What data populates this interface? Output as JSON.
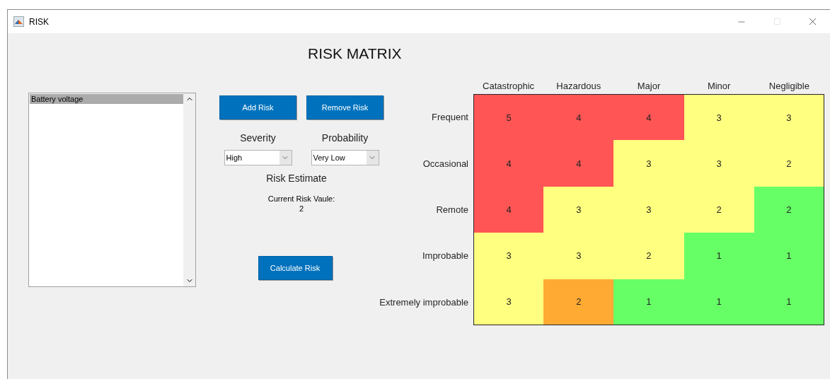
{
  "window": {
    "title": "RISK",
    "maximize_enabled": false
  },
  "heading": "RISK MATRIX",
  "risk_list": {
    "items": [
      {
        "label": "Battery voltage",
        "selected": true
      }
    ]
  },
  "buttons": {
    "add": "Add Risk",
    "remove": "Remove Risk",
    "calculate": "Calculate Risk"
  },
  "severity": {
    "label": "Severity",
    "value": "High"
  },
  "probability": {
    "label": "Probability",
    "value": "Very Low"
  },
  "estimate": {
    "title": "Risk Estimate",
    "caption": "Current Risk Vaule:",
    "value": "2"
  },
  "matrix": {
    "columns": [
      "Catastrophic",
      "Hazardous",
      "Major",
      "Minor",
      "Negligible"
    ],
    "rows": [
      {
        "label": "Frequent",
        "cells": [
          {
            "value": "5",
            "color": "#ff5555"
          },
          {
            "value": "4",
            "color": "#ff5555"
          },
          {
            "value": "4",
            "color": "#ff5555"
          },
          {
            "value": "3",
            "color": "#ffff80"
          },
          {
            "value": "3",
            "color": "#ffff80"
          }
        ]
      },
      {
        "label": "Occasional",
        "cells": [
          {
            "value": "4",
            "color": "#ff5555"
          },
          {
            "value": "4",
            "color": "#ff5555"
          },
          {
            "value": "3",
            "color": "#ffff80"
          },
          {
            "value": "3",
            "color": "#ffff80"
          },
          {
            "value": "2",
            "color": "#ffff80"
          }
        ]
      },
      {
        "label": "Remote",
        "cells": [
          {
            "value": "4",
            "color": "#ff5555"
          },
          {
            "value": "3",
            "color": "#ffff80"
          },
          {
            "value": "3",
            "color": "#ffff80"
          },
          {
            "value": "2",
            "color": "#ffff80"
          },
          {
            "value": "2",
            "color": "#66ff66"
          }
        ]
      },
      {
        "label": "Improbable",
        "cells": [
          {
            "value": "3",
            "color": "#ffff80"
          },
          {
            "value": "3",
            "color": "#ffff80"
          },
          {
            "value": "2",
            "color": "#ffff80"
          },
          {
            "value": "1",
            "color": "#66ff66"
          },
          {
            "value": "1",
            "color": "#66ff66"
          }
        ]
      },
      {
        "label": "Extremely improbable",
        "cells": [
          {
            "value": "3",
            "color": "#ffff80"
          },
          {
            "value": "2",
            "color": "#ffaa33"
          },
          {
            "value": "1",
            "color": "#66ff66"
          },
          {
            "value": "1",
            "color": "#66ff66"
          },
          {
            "value": "1",
            "color": "#66ff66"
          }
        ]
      }
    ]
  }
}
